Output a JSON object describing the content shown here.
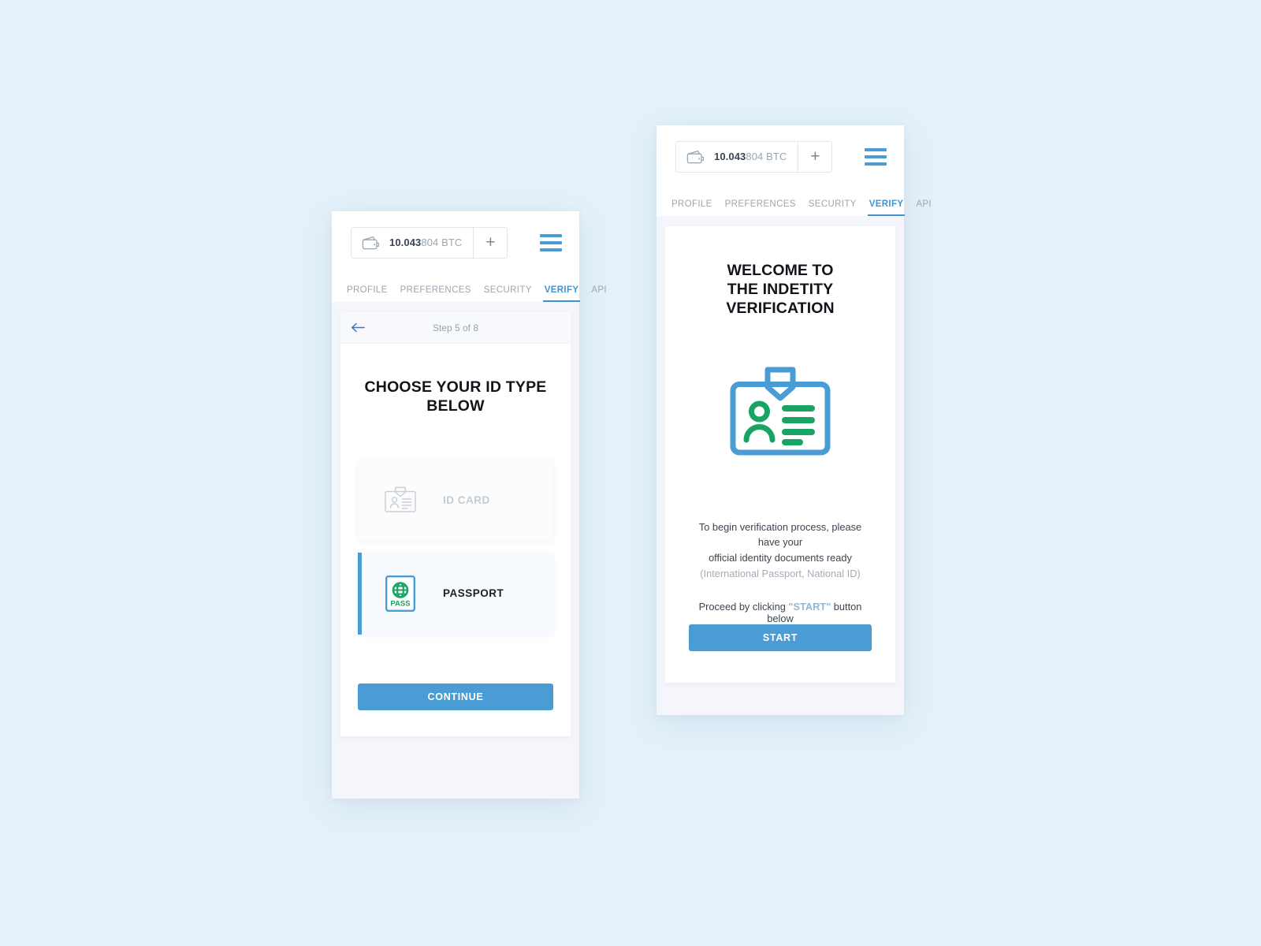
{
  "theme": {
    "page_background": "#e4f1fa",
    "accent_blue": "#4a9dd4",
    "accent_green": "#19a463",
    "muted_gray": "#9aa6b2",
    "panel_background": "#ffffff",
    "phone_background": "#f4f6fb"
  },
  "header": {
    "wallet_icon": "wallet-icon",
    "balance_major": "10.043",
    "balance_minor": "804 BTC",
    "add_label": "+",
    "menu_icon": "hamburger-menu-icon"
  },
  "tabs": [
    {
      "label": "PROFILE",
      "active": false
    },
    {
      "label": "PREFERENCES",
      "active": false
    },
    {
      "label": "SECURITY",
      "active": false
    },
    {
      "label": "VERIFY",
      "active": true
    },
    {
      "label": "API",
      "active": false
    }
  ],
  "left_phone": {
    "step": {
      "back_icon": "back-arrow-icon",
      "label": "Step 5 of 8"
    },
    "title_line1": "CHOOSE YOUR ID TYPE",
    "title_line2": "BELOW",
    "options": [
      {
        "label": "ID CARD",
        "icon": "id-card-icon",
        "selected": false
      },
      {
        "label": "PASSPORT",
        "icon": "passport-icon",
        "selected": true
      }
    ],
    "passport_icon_text": "PASS",
    "continue_label": "CONTINUE"
  },
  "right_phone": {
    "title_line1": "WELCOME TO",
    "title_line2": "THE INDETITY VERIFICATION",
    "hero_icon": "id-badge-illustration",
    "body_line1": "To begin verification process, please have your",
    "body_line2": "official identity documents ready",
    "body_line3": "(International Passport, National ID)",
    "proceed_prefix": "Proceed by clicking ",
    "proceed_quoted": "\"START\"",
    "proceed_suffix": " button below",
    "start_label": "START"
  }
}
